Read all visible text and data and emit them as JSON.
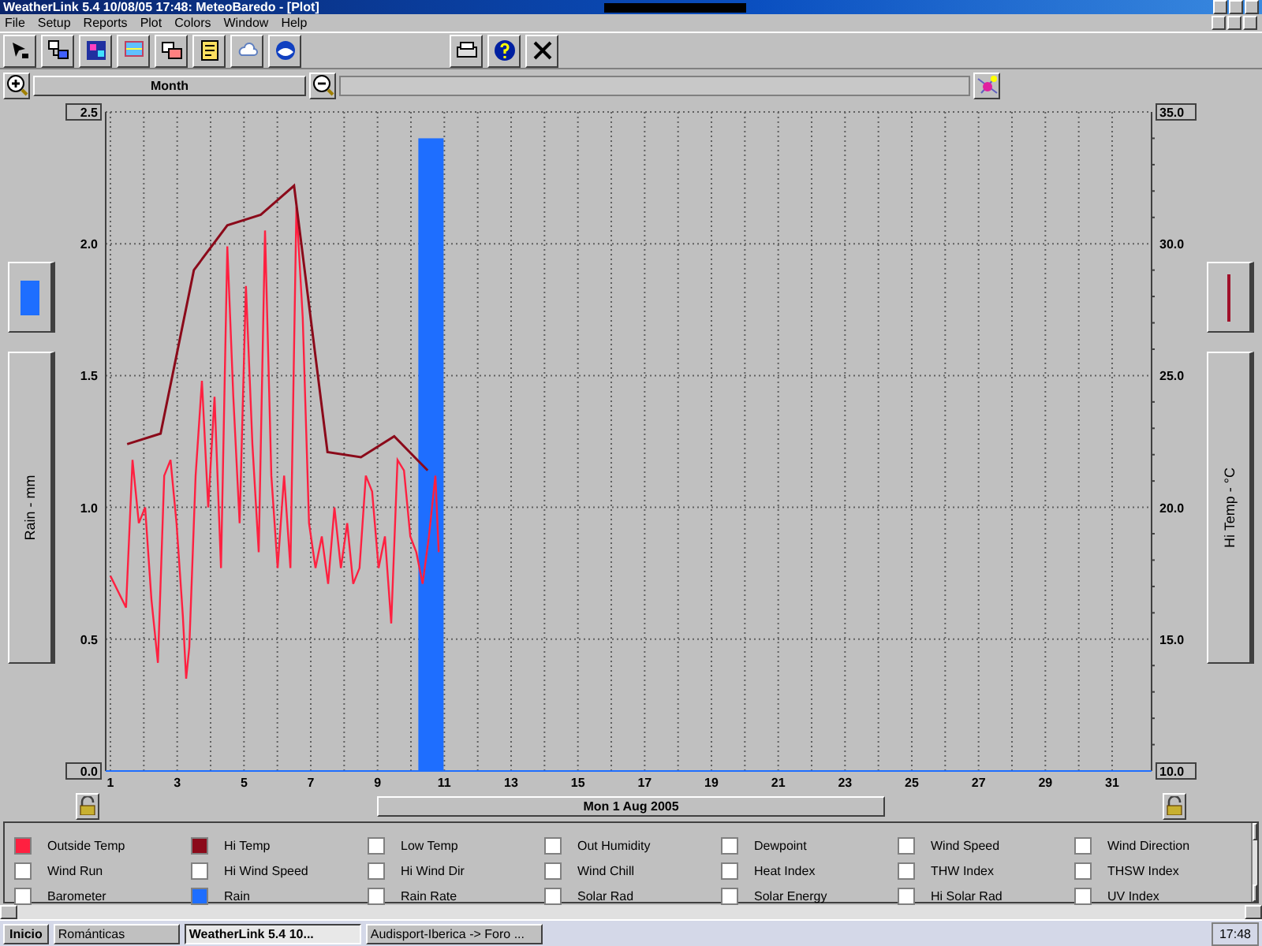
{
  "window": {
    "title": "WeatherLink 5.4  10/08/05  17:48: MeteoBaredo - [Plot]"
  },
  "menu": [
    "File",
    "Setup",
    "Reports",
    "Plot",
    "Colors",
    "Window",
    "Help"
  ],
  "zoom_bar": {
    "period": "Month"
  },
  "left_panel": {
    "label": "Rain - mm",
    "kind": "bar",
    "color": "#1e6eff"
  },
  "right_panel": {
    "label": "Hi Temp - °C",
    "kind": "line",
    "color": "#a0102a"
  },
  "chart_data": {
    "type": "line",
    "grid": true,
    "xlim": [
      1,
      31
    ],
    "xticks": [
      1,
      3,
      5,
      7,
      9,
      11,
      13,
      15,
      17,
      19,
      21,
      23,
      25,
      27,
      29,
      31
    ],
    "ylim": [
      0,
      2.5
    ],
    "yticks": [
      {
        "value": 0,
        "label": "0.0"
      },
      {
        "value": 0.5,
        "label": "0.5"
      },
      {
        "value": 1,
        "label": "1.0"
      },
      {
        "value": 1.5,
        "label": "1.5"
      },
      {
        "value": 2,
        "label": "2.0"
      },
      {
        "value": 2.5,
        "label": "2.5"
      }
    ],
    "y2lim": [
      10,
      35
    ],
    "y2ticks": [
      {
        "value": 10,
        "label": "10.0"
      },
      {
        "value": 15,
        "label": "15.0"
      },
      {
        "value": 20,
        "label": "20.0"
      },
      {
        "value": 25,
        "label": "25.0"
      },
      {
        "value": 30,
        "label": "30.0"
      },
      {
        "value": 35,
        "label": "35.0"
      }
    ],
    "series": [
      {
        "name": "Outside Temp",
        "type": "line",
        "axis": "y2",
        "color": "#ff2040",
        "x": [
          1.0,
          1.47,
          1.66,
          1.85,
          2.04,
          2.23,
          2.42,
          2.61,
          2.8,
          2.98,
          3.17,
          3.27,
          3.36,
          3.55,
          3.74,
          3.93,
          4.12,
          4.31,
          4.5,
          4.68,
          4.87,
          5.06,
          5.25,
          5.44,
          5.63,
          5.82,
          6.01,
          6.2,
          6.39,
          6.57,
          6.76,
          6.95,
          7.14,
          7.33,
          7.52,
          7.71,
          7.9,
          8.09,
          8.27,
          8.46,
          8.65,
          8.84,
          9.03,
          9.22,
          9.41,
          9.6,
          9.79,
          9.98,
          10.16,
          10.35,
          10.54,
          10.73,
          10.83
        ],
        "values": [
          17.4,
          16.2,
          21.8,
          19.4,
          20.0,
          16.5,
          14.1,
          21.2,
          21.8,
          19.4,
          15.9,
          13.5,
          14.7,
          21.2,
          24.8,
          20.0,
          24.2,
          17.7,
          29.9,
          24.2,
          19.4,
          28.4,
          22.4,
          18.3,
          30.5,
          21.2,
          17.7,
          21.2,
          17.7,
          31.4,
          27.2,
          19.4,
          17.7,
          18.9,
          17.1,
          20.0,
          17.7,
          19.4,
          17.1,
          17.7,
          21.2,
          20.6,
          17.7,
          18.9,
          15.6,
          21.8,
          21.4,
          18.9,
          18.3,
          17.1,
          18.9,
          21.2,
          18.3
        ]
      },
      {
        "name": "Hi Temp",
        "type": "line",
        "axis": "y2",
        "color": "#8b0a1a",
        "x": [
          1.5,
          2.5,
          3.5,
          4.5,
          5.5,
          6.5,
          7.5,
          8.5,
          9.5,
          10.5
        ],
        "values": [
          22.4,
          22.8,
          29.0,
          30.7,
          31.1,
          32.2,
          22.1,
          21.9,
          22.7,
          21.4
        ]
      },
      {
        "name": "Rain",
        "type": "bar",
        "axis": "y",
        "color": "#1e6eff",
        "x": [
          10.6
        ],
        "values": [
          2.4
        ]
      }
    ]
  },
  "date_button": "Mon 1 Aug 2005",
  "legend": {
    "items": [
      {
        "kind": "series",
        "checked": true
      },
      {
        "kind": "series",
        "checked": true
      },
      {
        "label": "Low Temp",
        "checked": false
      },
      {
        "label": "Out Humidity",
        "checked": false
      },
      {
        "label": "Dewpoint",
        "checked": false
      },
      {
        "label": "Wind Speed",
        "checked": false
      },
      {
        "label": "Wind Direction",
        "checked": false
      },
      {
        "label": "Wind Run",
        "checked": false
      },
      {
        "label": "Hi Wind Speed",
        "checked": false
      },
      {
        "label": "Hi Wind Dir",
        "checked": false
      },
      {
        "label": "Wind Chill",
        "checked": false
      },
      {
        "label": "Heat Index",
        "checked": false
      },
      {
        "label": "THW Index",
        "checked": false
      },
      {
        "label": "THSW Index",
        "checked": false
      },
      {
        "label": "Barometer",
        "checked": false
      },
      {
        "kind": "series",
        "checked": true
      },
      {
        "label": "Rain Rate",
        "checked": false
      },
      {
        "label": "Solar Rad",
        "checked": false
      },
      {
        "label": "Solar Energy",
        "checked": false
      },
      {
        "label": "Hi Solar Rad",
        "checked": false
      },
      {
        "label": "UV Index",
        "checked": false
      }
    ]
  },
  "taskbar": {
    "start": "Inicio",
    "buttons": [
      {
        "label": "Románticas",
        "selected": false
      },
      {
        "label": "WeatherLink 5.4  10...",
        "selected": true
      },
      {
        "label": "Audisport-Iberica -> Foro ...",
        "selected": false
      }
    ],
    "clock": "17:48"
  }
}
